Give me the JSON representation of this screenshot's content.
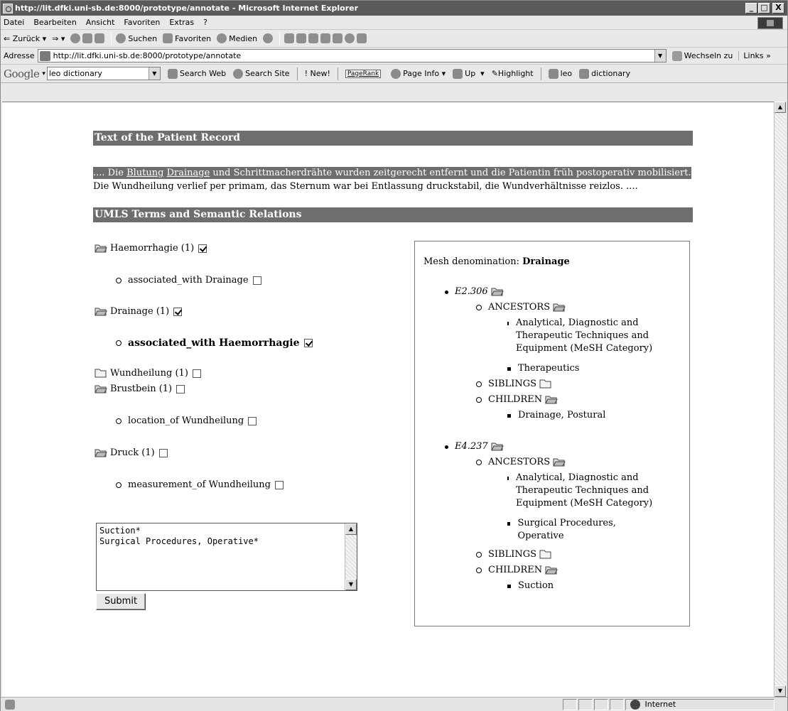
{
  "window": {
    "title": "http://lit.dfki.uni-sb.de:8000/prototype/annotate - Microsoft Internet Explorer",
    "min_label": "_",
    "max_label": "□",
    "close_label": "X"
  },
  "menu": {
    "items": [
      "Datei",
      "Bearbeiten",
      "Ansicht",
      "Favoriten",
      "Extras",
      "?"
    ]
  },
  "toolbar": {
    "back_label": "Zurück",
    "search_label": "Suchen",
    "favorites_label": "Favoriten",
    "media_label": "Medien"
  },
  "address": {
    "label": "Adresse",
    "url": "http://lit.dfki.uni-sb.de:8000/prototype/annotate",
    "go_label": "Wechseln zu",
    "links_label": "Links »"
  },
  "google": {
    "logo": "Google",
    "search_value": "leo dictionary",
    "search_web": "Search Web",
    "search_site": "Search Site",
    "new_label": "New!",
    "pagerank": "PageRank",
    "page_info": "Page Info",
    "up": "Up",
    "highlight": "Highlight",
    "leo": "leo",
    "dictionary": "dictionary"
  },
  "page": {
    "record_header": "Text of the Patient Record",
    "record_line1_pre": ".... Die ",
    "record_line1_link1": "Blutung",
    "record_line1_sp": " ",
    "record_line1_link2": "Drainage",
    "record_line1_post": " und Schrittmacherdrähte wurden zeitgerecht entfernt und die Patientin früh postoperativ mobilisiert.",
    "record_line2": "Die Wundheilung verlief per primam, das Sternum war bei Entlassung druckstabil, die Wundverhältnisse reizlos. ....",
    "umls_header": "UMLS Terms and Semantic Relations",
    "terms": [
      {
        "label": "Haemorrhagie (1)",
        "checked": true
      },
      {
        "label": "Drainage (1)",
        "checked": true
      },
      {
        "label": "Wundheilung (1)",
        "checked": false
      },
      {
        "label": "Brustbein (1)",
        "checked": false
      },
      {
        "label": "Druck (1)",
        "checked": false
      }
    ],
    "relations": [
      {
        "label": "associated_with Drainage",
        "checked": false
      },
      {
        "label": "associated_with Haemorrhagie",
        "checked": true
      },
      {
        "label": "location_of Wundheilung",
        "checked": false
      },
      {
        "label": "measurement_of Wundheilung",
        "checked": false
      }
    ],
    "textarea_value": "Suction*\nSurgical Procedures, Operative*",
    "submit_label": "Submit"
  },
  "mesh": {
    "prefix": "Mesh denomination: ",
    "term": "Drainage",
    "entries": [
      {
        "code": "E2.306",
        "ancestors_label": "ANCESTORS",
        "ancestors": [
          "Analytical, Diagnostic and Therapeutic Techniques and Equipment (MeSH Category)",
          "Therapeutics"
        ],
        "siblings_label": "SIBLINGS",
        "children_label": "CHILDREN",
        "children": [
          "Drainage, Postural"
        ]
      },
      {
        "code": "E4.237",
        "ancestors_label": "ANCESTORS",
        "ancestors": [
          "Analytical, Diagnostic and Therapeutic Techniques and Equipment (MeSH Category)",
          "Surgical Procedures, Operative"
        ],
        "siblings_label": "SIBLINGS",
        "children_label": "CHILDREN",
        "children": [
          "Suction"
        ]
      }
    ]
  },
  "status": {
    "zone": "Internet"
  },
  "colors": {
    "header_bg": "#6e6e6e",
    "titlebar_bg": "#5a5a5a"
  }
}
